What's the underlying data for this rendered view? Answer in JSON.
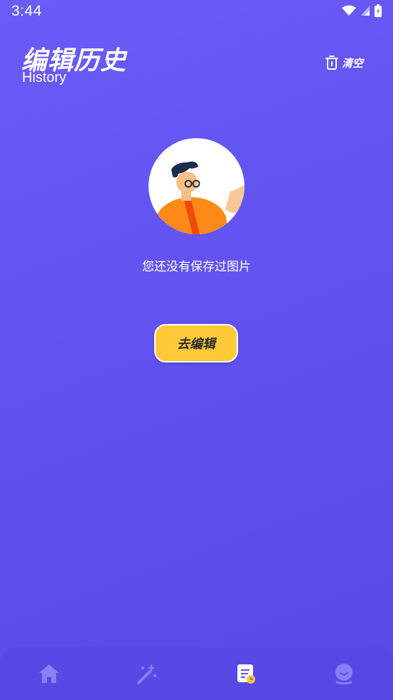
{
  "status": {
    "time": "3:44"
  },
  "header": {
    "title": "编辑历史",
    "subtitle": "History",
    "clear_label": "清空"
  },
  "empty_state": {
    "message": "您还没有保存过图片",
    "button_label": "去编辑"
  },
  "tab_bar": {
    "items": [
      {
        "icon": "home-icon",
        "active": false
      },
      {
        "icon": "magic-wand-icon",
        "active": false
      },
      {
        "icon": "history-icon",
        "active": true
      },
      {
        "icon": "profile-icon",
        "active": false
      }
    ]
  },
  "colors": {
    "button_yellow": "#ffc93a",
    "background": "#6152ef",
    "tab_inactive": "#8a7ef5"
  }
}
